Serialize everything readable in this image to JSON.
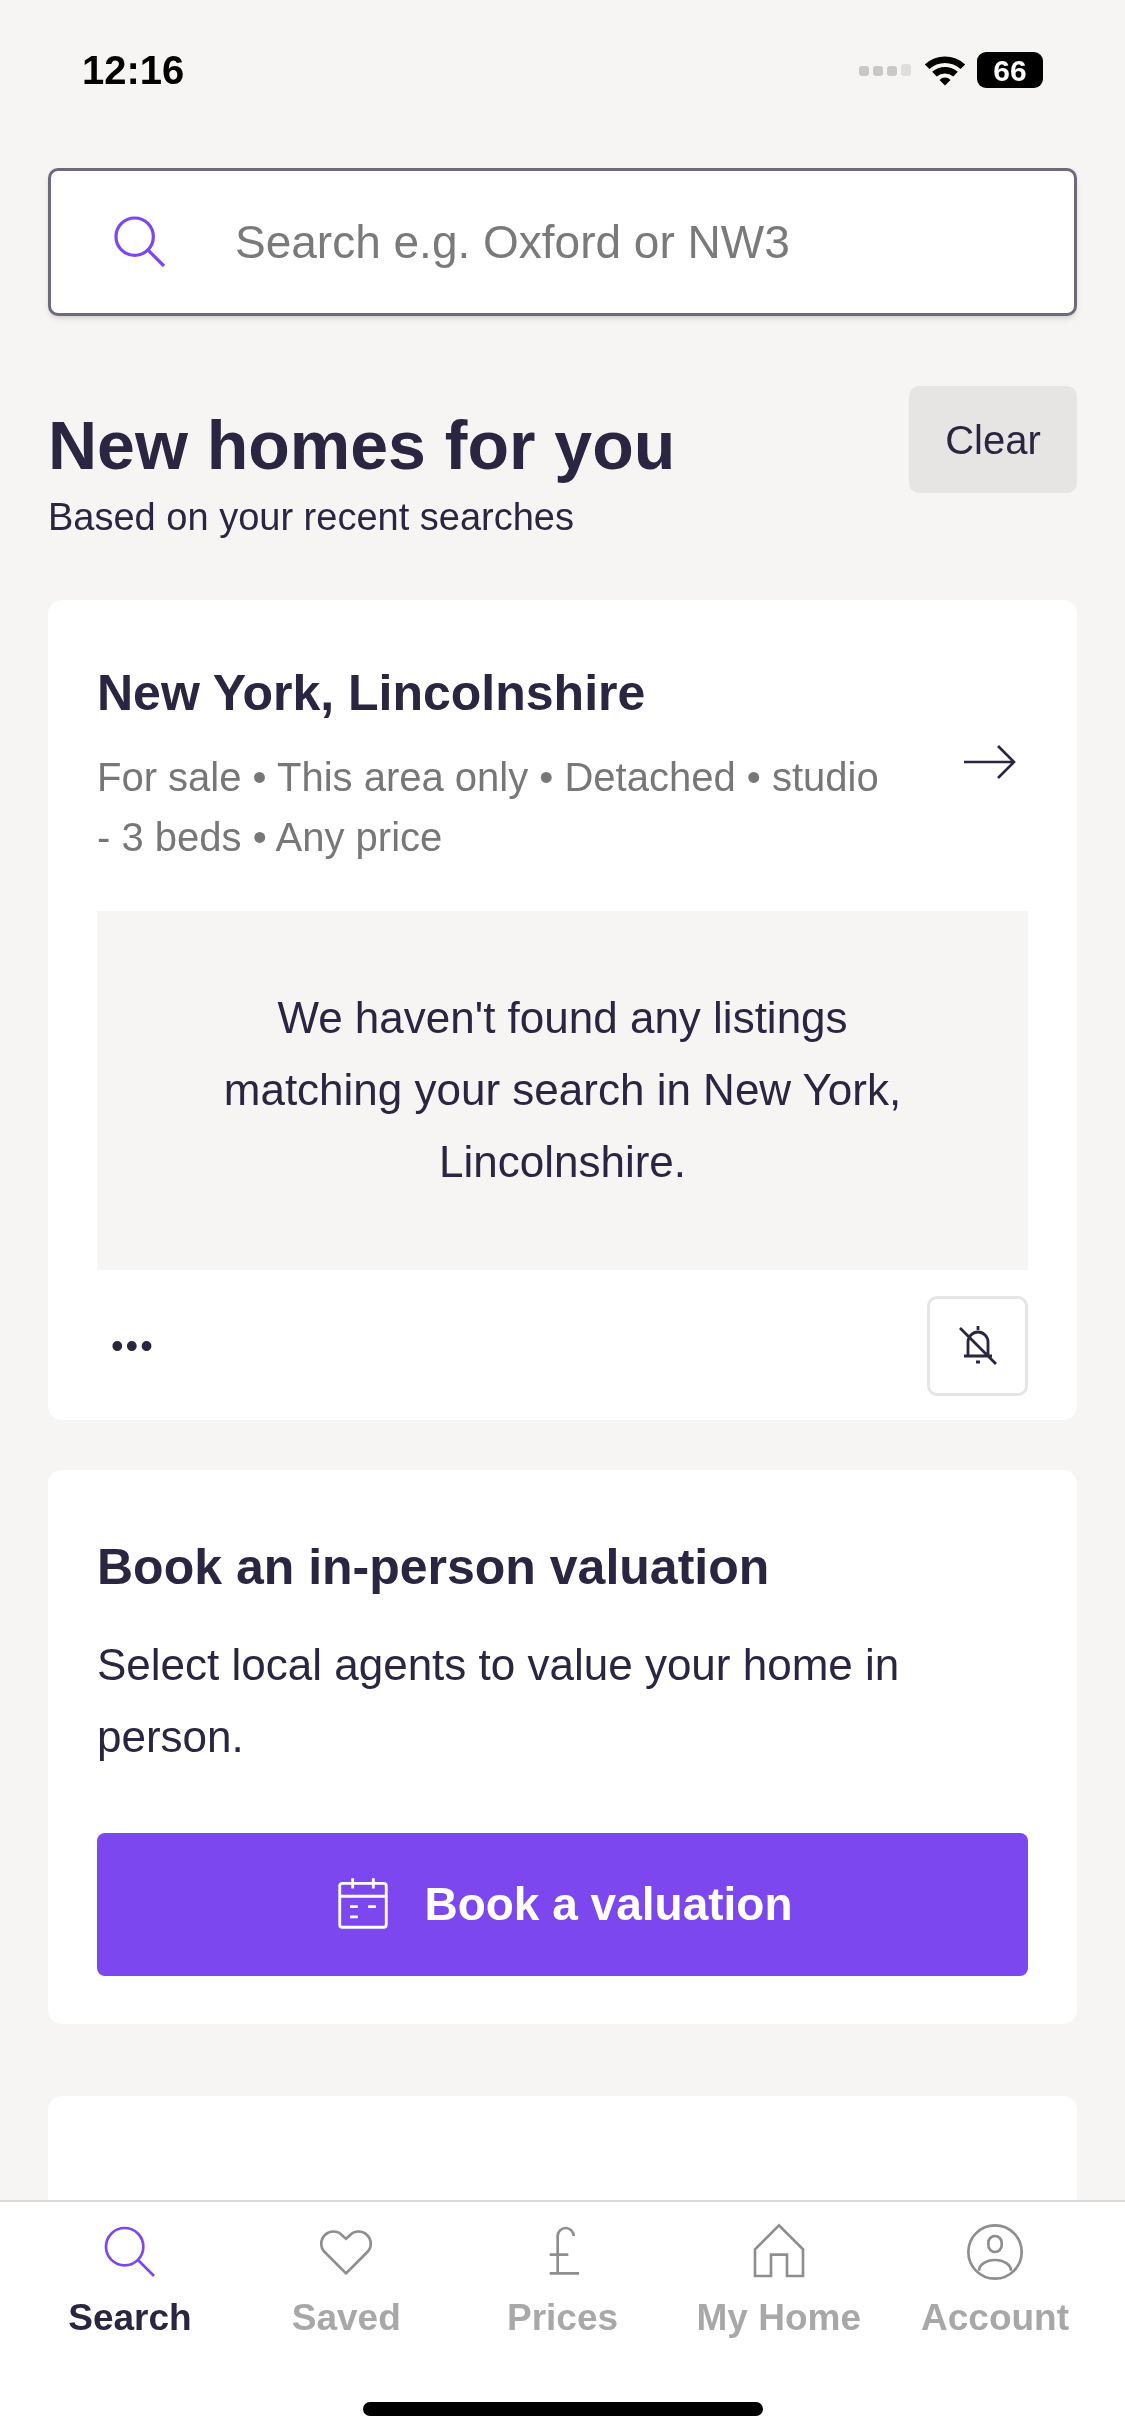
{
  "status_bar": {
    "time": "12:16",
    "battery": "66"
  },
  "search": {
    "placeholder": "Search e.g. Oxford or NW3"
  },
  "section": {
    "title": "New homes for you",
    "subtitle": "Based on your recent searches",
    "clear_button": "Clear"
  },
  "saved_search": {
    "title": "New York, Lincolnshire",
    "criteria": "For sale • This area only • Detached • studio - 3 beds • Any price",
    "empty_message": "We haven't found any listings matching your search in New York, Lincolnshire.",
    "more_button": "•••",
    "alerts_on": false
  },
  "valuation": {
    "title": "Book an in-person valuation",
    "description": "Select local agents to value your home in person.",
    "button": "Book a valuation"
  },
  "tabs": [
    {
      "label": "Search",
      "kind": "search",
      "selected": true
    },
    {
      "label": "Saved",
      "kind": "heart",
      "selected": false
    },
    {
      "label": "Prices",
      "kind": "pound",
      "selected": false
    },
    {
      "label": "My Home",
      "kind": "home",
      "selected": false
    },
    {
      "label": "Account",
      "kind": "account",
      "selected": false
    }
  ]
}
